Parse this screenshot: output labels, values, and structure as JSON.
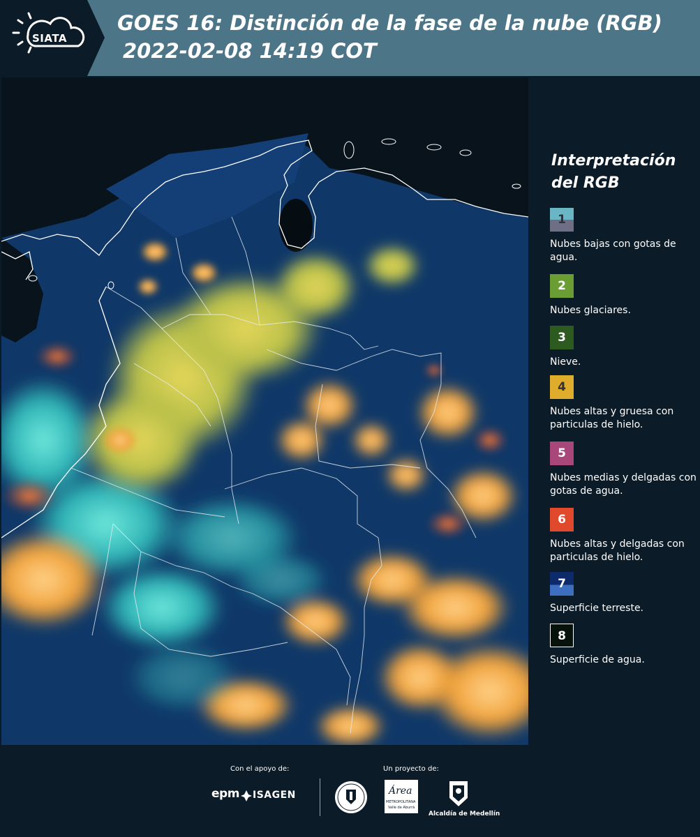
{
  "header": {
    "logo_text": "SIATA",
    "title": "GOES 16: Distinción de la fase de la nube (RGB)",
    "subtitle": "2022-02-08 14:19 COT",
    "background_color": "#4c7688",
    "logo_background_color": "#0b1b28"
  },
  "legend": {
    "title": "Interpretación del RGB",
    "items": [
      {
        "number": "1",
        "label": "Nubes bajas con gotas de agua.",
        "colors": [
          "#6ab6c4",
          "#6e6e86"
        ]
      },
      {
        "number": "2",
        "label": "Nubes glaciares.",
        "colors": [
          "#6a9e35"
        ]
      },
      {
        "number": "3",
        "label": "Nieve.",
        "colors": [
          "#2c5a1f"
        ]
      },
      {
        "number": "4",
        "label": "Nubes altas y gruesa con particulas de hielo.",
        "colors": [
          "#e0ac2b"
        ]
      },
      {
        "number": "5",
        "label": "Nubes medias y delgadas con gotas de agua.",
        "colors": [
          "#a9467a"
        ]
      },
      {
        "number": "6",
        "label": "Nubes altas y delgadas con particulas de hielo.",
        "colors": [
          "#e0492c"
        ]
      },
      {
        "number": "7",
        "label": "Superficie terreste.",
        "colors": [
          "#0d2a6a",
          "#3d6ec0"
        ]
      },
      {
        "number": "8",
        "label": "Superficie de agua.",
        "colors": [
          "#07130a"
        ]
      }
    ]
  },
  "footer": {
    "support_label": "Con el apoyo de:",
    "project_label": "Un proyecto de:",
    "sponsors": [
      "epm",
      "ISAGEN"
    ],
    "partners": [
      "Área Metropolitana Valle de Aburrá",
      "Alcaldía de Medellín"
    ],
    "epm_text": "epm",
    "isagen_text": "ISAGEN",
    "area_text": "Área",
    "area_sub": "METROPOLITANA",
    "area_sub2": "Valle de Aburrá",
    "alcaldia_text": "Alcaldía de Medellín"
  },
  "map": {
    "description_icon": "satellite-image",
    "colors": {
      "ocean": "#07131b",
      "land": "#123a6a",
      "warm_cloud": "#e8a93a",
      "cool_cloud": "#3fd1c6",
      "border": "#ffffff"
    }
  }
}
